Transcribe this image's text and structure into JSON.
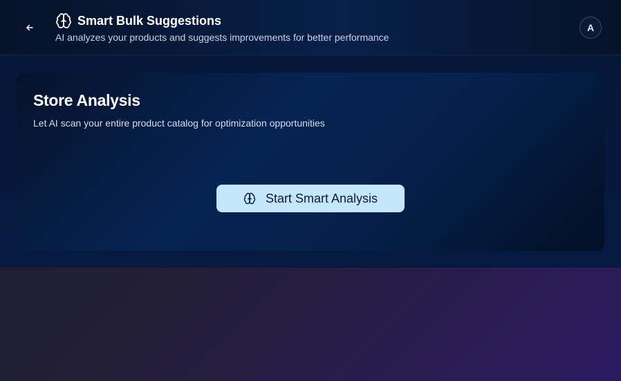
{
  "header": {
    "back_icon": "arrow-left-icon",
    "title_icon": "brain-icon",
    "title": "Smart Bulk Suggestions",
    "subtitle": "AI analyzes your products and suggests improvements for better performance",
    "avatar_initial": "A"
  },
  "card": {
    "title": "Store Analysis",
    "description": "Let AI scan your entire product catalog for optimization opportunities",
    "button_icon": "brain-icon",
    "button_label": "Start Smart Analysis"
  },
  "colors": {
    "header_bg": "#061a3a",
    "panel_bg": "#061a40",
    "button_bg": "#c4e6fc",
    "button_text": "#0f1c33",
    "page_gradient_end": "#2e1a62"
  }
}
